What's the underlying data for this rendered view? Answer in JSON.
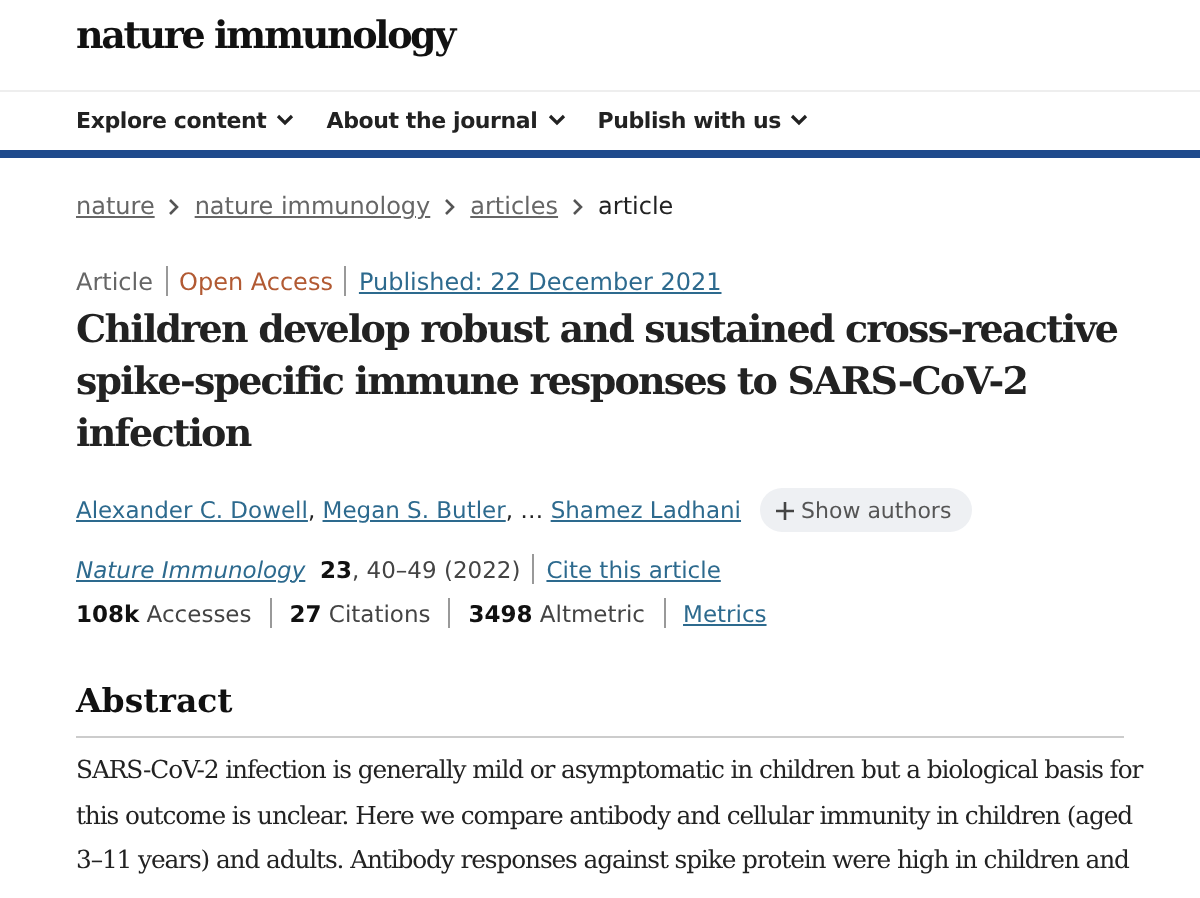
{
  "header": {
    "logo": "nature immunology"
  },
  "nav": [
    {
      "label": "Explore content"
    },
    {
      "label": "About the journal"
    },
    {
      "label": "Publish with us"
    }
  ],
  "breadcrumb": [
    {
      "label": "nature",
      "kind": "link"
    },
    {
      "label": "nature immunology",
      "kind": "link"
    },
    {
      "label": "articles",
      "kind": "link"
    },
    {
      "label": "article",
      "kind": "current"
    }
  ],
  "article": {
    "type": "Article",
    "access": "Open Access",
    "published": "Published: 22 December 2021",
    "title": "Children develop robust and sustained cross-reactive spike-specific immune responses to SARS-CoV-2 infection",
    "authors": [
      "Alexander C. Dowell",
      "Megan S. Butler",
      "Shamez Ladhani"
    ],
    "authors_separator": ",",
    "authors_ellipsis": ", …",
    "show_authors": "Show authors",
    "journal": "Nature Immunology",
    "volume": "23",
    "pages": ", 40–49 (2022)",
    "cite": "Cite this article",
    "metrics": [
      "**108k** Accesses",
      "**27** Citations",
      "**3498** Altmetric"
    ],
    "metrics_link": "Metrics"
  },
  "abstract": {
    "heading": "Abstract",
    "lines": [
      "SARS-CoV-2 infection is generally mild or asymptomatic in children but a biological basis for",
      "this outcome is unclear. Here we compare antibody and cellular immunity in children (aged",
      "3–11 years) and adults. Antibody responses against spike protein were high in children and"
    ]
  }
}
